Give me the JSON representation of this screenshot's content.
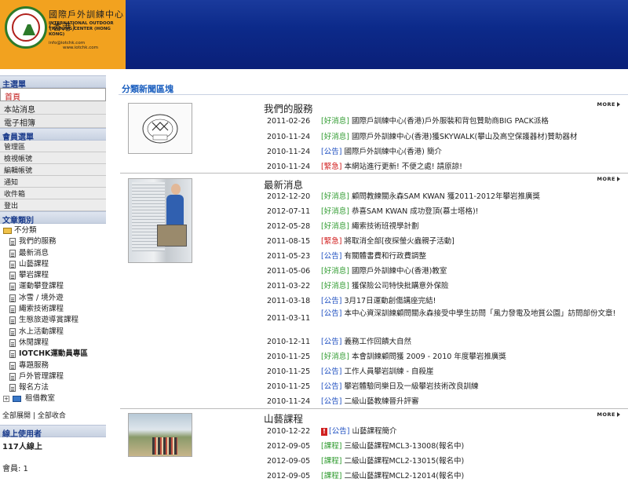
{
  "header": {
    "logo_cn": "國際戶外訓練中心(香港)",
    "logo_en": "INTERNATIONAL OUTDOOR TRAINING CENTER (HONG KONG)",
    "logo_email": "info@iotchk.com",
    "logo_web": "www.iotchk.com",
    "logo_seal_text": "International Outdoor Training Center",
    "colors": {
      "banner": "#0c2a8a",
      "logo_bg": "#f2a21f"
    }
  },
  "sidebar": {
    "main_menu_title": "主選單",
    "main_menu": [
      "首頁",
      "本站消息",
      "電子相簿"
    ],
    "member_menu_title": "會員選單",
    "member_menu": [
      "管理區",
      "檢視帳號",
      "編輯帳號",
      "通知",
      "收件箱",
      "登出"
    ],
    "category_title": "文章類別",
    "category_root": "不分類",
    "categories": [
      "我們的服務",
      "最新消息",
      "山藝課程",
      "攀岩課程",
      "運動攀登課程",
      "冰雪 / 境外遊",
      "繩索技術課程",
      "生態旅遊導賞課程",
      "水上活動課程",
      "休閒課程",
      "IOTCHK運動員專區",
      "專題服務",
      "戶外管理課程",
      "報名方法"
    ],
    "category_folder": "租借教室",
    "expand_all": "全部展開",
    "collapse_all": "全部收合",
    "separator": "|",
    "online_title": "線上使用者",
    "online_count": "117人線上",
    "member_count": "會員: 1"
  },
  "main": {
    "title": "分類新聞區塊",
    "more_label": "MORE",
    "sections": [
      {
        "title": "我們的服務",
        "rows": [
          {
            "date": "2011-02-26",
            "tag": "[好消息]",
            "text": "國際戶訓練中心(香港)戶外服裝和背包贊助商BIG PACK派格"
          },
          {
            "date": "2010-11-24",
            "tag": "[好消息]",
            "text": "國際戶外訓練中心(香港)獲SKYWALK(攀山及高空保護器材)贊助器材"
          },
          {
            "date": "2010-11-24",
            "tag": "[公告]",
            "text": "國際戶外訓練中心(香港) 簡介"
          },
          {
            "date": "2010-11-24",
            "tag": "[緊急]",
            "text": "本網站進行更新! 不便之處! 請原諒!"
          }
        ]
      },
      {
        "title": "最新消息",
        "rows": [
          {
            "date": "2012-12-20",
            "tag": "[好消息]",
            "text": "顧問教練關永森SAM KWAN 獲2011-2012年攀岩推廣獎"
          },
          {
            "date": "2012-07-11",
            "tag": "[好消息]",
            "text": "恭喜SAM KWAN 成功登頂(慕士塔格)!"
          },
          {
            "date": "2012-05-28",
            "tag": "[好消息]",
            "text": "繩索技術班視學計劃"
          },
          {
            "date": "2011-08-15",
            "tag": "[緊急]",
            "text": "將取消全部[夜探螢火蟲親子活動]"
          },
          {
            "date": "2011-05-23",
            "tag": "[公告]",
            "text": "有關體書費和行政費調整"
          },
          {
            "date": "2011-05-06",
            "tag": "[好消息]",
            "text": "國際戶外訓練中心(香港)教室"
          },
          {
            "date": "2011-03-22",
            "tag": "[好消息]",
            "text": "獲保險公司特快批購意外保險"
          },
          {
            "date": "2011-03-18",
            "tag": "[公告]",
            "text": "3月17日運動創傷講座完結!"
          },
          {
            "date": "2011-03-11",
            "tag": "[公告]",
            "text": "本中心資深訓練顧問關永森接受中學生訪問「風力發電及地質公園」訪問部份文章!"
          },
          {
            "date": "2010-12-11",
            "tag": "[公告]",
            "text": "義務工作回饋大自然"
          },
          {
            "date": "2010-11-25",
            "tag": "[好消息]",
            "text": "本會訓練顧問獲 2009 - 2010 年度攀岩推廣獎"
          },
          {
            "date": "2010-11-25",
            "tag": "[公告]",
            "text": "工作人員攀岩訓練 - 自殺崖"
          },
          {
            "date": "2010-11-25",
            "tag": "[公告]",
            "text": "攀岩體驗同樂日及一級攀岩技術改良訓練"
          },
          {
            "date": "2010-11-24",
            "tag": "[公告]",
            "text": "二級山藝教練晉升評審"
          }
        ]
      },
      {
        "title": "山藝課程",
        "rows": [
          {
            "date": "2010-12-22",
            "tag": "[公告]",
            "text": "山藝課程簡介"
          },
          {
            "date": "2012-09-05",
            "tag": "[課程]",
            "text": "三級山藝課程MCL3-13008(報名中)"
          },
          {
            "date": "2012-09-05",
            "tag": "[課程]",
            "text": "二級山藝課程MCL2-13015(報名中)"
          },
          {
            "date": "2012-09-05",
            "tag": "[課程]",
            "text": "二級山藝課程MCL2-12014(報名中)"
          }
        ]
      }
    ]
  }
}
